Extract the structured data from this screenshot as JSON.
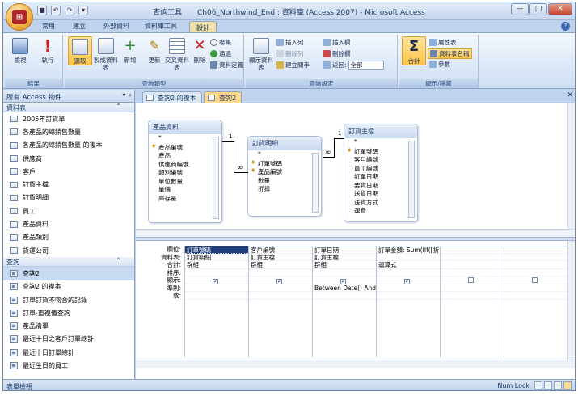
{
  "window": {
    "title": "Ch06_Northwind_End : 資料庫 (Access 2007) - Microsoft Access",
    "context_tool": "查詢工具",
    "minimize_label": "—",
    "maximize_label": "□",
    "close_label": "✕"
  },
  "tabs": [
    "常用",
    "建立",
    "外部資料",
    "資料庫工具",
    "設計"
  ],
  "ribbon": {
    "groups": {
      "results": "結果",
      "query_type": "查詢類型",
      "query_setup": "查詢設定",
      "show_hide": "顯示/隱藏"
    },
    "view": "檢視",
    "run": "執行",
    "select": "選取",
    "make_table": "製成資料表",
    "append": "新增",
    "update": "更新",
    "crosstab": "交叉資料表",
    "delete": "刪除",
    "union": "聯集",
    "pass_through": "通過",
    "data_definition": "資料定義",
    "show_table": "顯示資料表",
    "insert_rows": "插入列",
    "delete_rows": "刪除列",
    "builder": "建立關手",
    "insert_columns": "插入欄",
    "delete_columns": "刪除欄",
    "return_label": "返回:",
    "return_value": "全部",
    "totals": "合計",
    "property_sheet": "屬性表",
    "table_names": "資料表名稱",
    "parameters": "參數"
  },
  "nav": {
    "header": "所有 Access 物件",
    "tables_section": "資料表",
    "tables": [
      "2005年訂貨單",
      "各產品的總銷售數量",
      "各產品的總銷售數量 的複本",
      "供應商",
      "客戶",
      "訂貨主檔",
      "訂貨明細",
      "員工",
      "產品資料",
      "產品類別",
      "貨運公司"
    ],
    "queries_section": "查詢",
    "queries": [
      "查詢2",
      "查詢2 的複本",
      "訂單訂貨不吻合的記錄",
      "訂單-重複值查詢",
      "產品清單",
      "最近十日之客戶訂單總計",
      "最近十日訂單總計",
      "最近生日的員工"
    ]
  },
  "doc_tabs": [
    "查詢2 的複本",
    "查詢2"
  ],
  "tables_diagram": [
    {
      "title": "產品資料",
      "fields": [
        "*",
        "產品編號",
        "產品",
        "供應商編號",
        "類別編號",
        "單位數量",
        "單價",
        "庫存量"
      ],
      "keys": [
        1
      ]
    },
    {
      "title": "訂貨明細",
      "fields": [
        "*",
        "訂單號碼",
        "產品編號",
        "數量",
        "折扣"
      ],
      "keys": [
        1,
        2
      ]
    },
    {
      "title": "訂貨主檔",
      "fields": [
        "*",
        "訂單號碼",
        "客戶編號",
        "員工編號",
        "訂單日期",
        "要貨日期",
        "送貨日期",
        "送貨方式",
        "運費"
      ],
      "keys": [
        1
      ]
    }
  ],
  "relationships": {
    "one": "1",
    "many": "∞"
  },
  "grid": {
    "row_labels": [
      "欄位:",
      "資料表:",
      "合計:",
      "排序:",
      "顯示:",
      "準則:",
      "或:"
    ],
    "columns": [
      {
        "field": "訂單號碼",
        "table": "訂貨明細",
        "total": "群組",
        "sort": "",
        "show": true,
        "criteria": ""
      },
      {
        "field": "客戶編號",
        "table": "訂貨主檔",
        "total": "群組",
        "sort": "",
        "show": true,
        "criteria": ""
      },
      {
        "field": "訂單日期",
        "table": "訂貨主檔",
        "total": "群組",
        "sort": "",
        "show": true,
        "criteria": "Between Date() And Do"
      },
      {
        "field": "訂單金額: Sum(IIf([折",
        "table": "",
        "total": "運算式",
        "sort": "",
        "show": true,
        "criteria": ""
      },
      {
        "field": "",
        "table": "",
        "total": "",
        "sort": "",
        "show": false,
        "criteria": ""
      },
      {
        "field": "",
        "table": "",
        "total": "",
        "sort": "",
        "show": false,
        "criteria": ""
      }
    ]
  },
  "status": {
    "left": "表單檢視",
    "right": "Num Lock"
  }
}
